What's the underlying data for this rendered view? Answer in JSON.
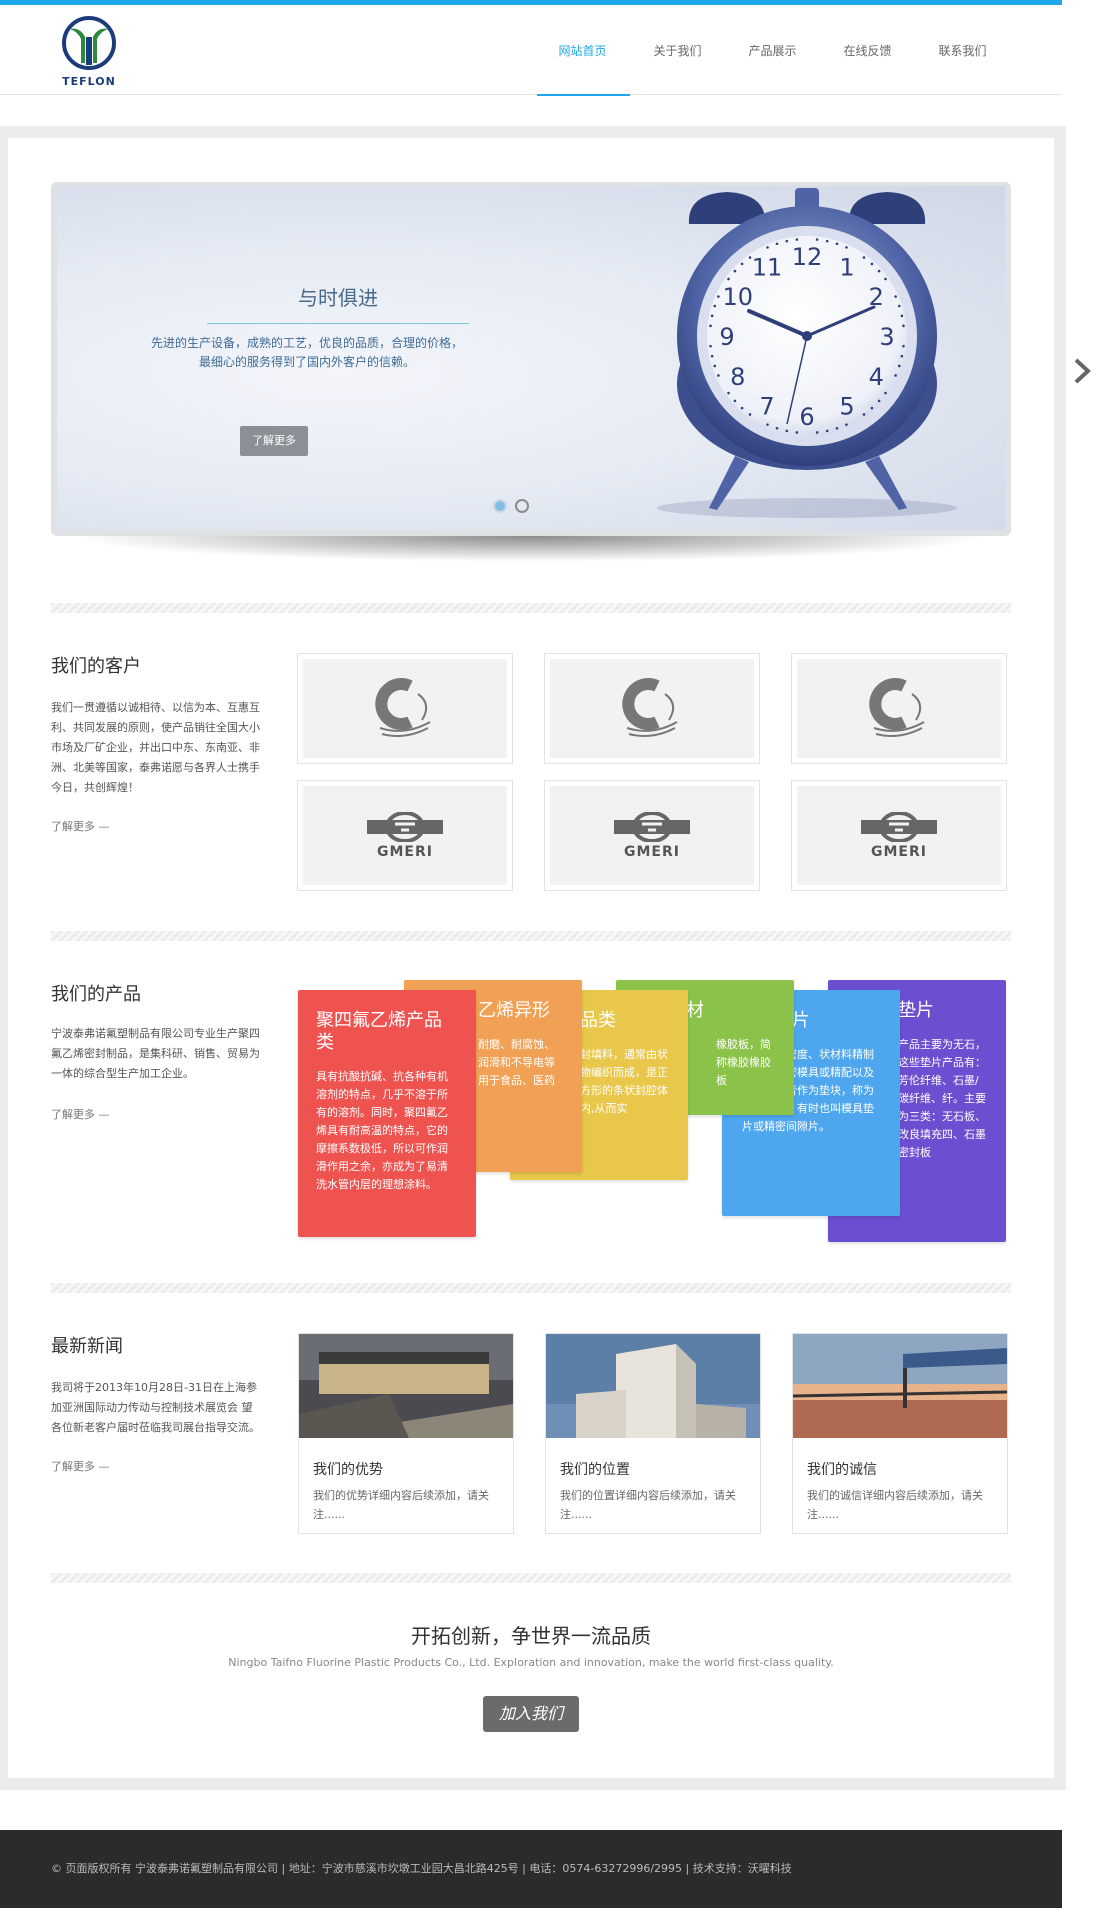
{
  "brand": {
    "logo_text": "TEFLON",
    "accent": "#1fa7e9"
  },
  "nav": {
    "items": [
      {
        "label": "网站首页",
        "active": true
      },
      {
        "label": "关于我们",
        "active": false
      },
      {
        "label": "产品展示",
        "active": false
      },
      {
        "label": "在线反馈",
        "active": false
      },
      {
        "label": "联系我们",
        "active": false
      }
    ]
  },
  "slider": {
    "title": "与时俱进",
    "text": "先进的生产设备，成熟的工艺，优良的品质，合理的价格，最细心的服务得到了国内外客户的信赖。",
    "button": "了解更多",
    "clock_numbers": [
      "12",
      "1",
      "2",
      "3",
      "4",
      "5",
      "6",
      "7",
      "8",
      "9",
      "10",
      "11"
    ]
  },
  "clients": {
    "title": "我们的客户",
    "text": "我们一贯遵循以诚相待、以信为本、互惠互利、共同发展的原则，使产品销往全国大小市场及厂矿企业，并出口中东、东南亚、非洲、北美等国家，泰弗诺愿与各界人士携手今日，共创辉煌！",
    "more": "了解更多 —",
    "logo_text": "GMERI"
  },
  "products": {
    "title": "我们的产品",
    "text": "宁波泰弗诺氟塑制品有限公司专业生产聚四氟乙烯密封制品，是集科研、销售、贸易为一体的综合型生产加工企业。",
    "more": "了解更多 —",
    "cards": [
      {
        "title": "聚四氟乙烯产品类",
        "text": "具有抗酸抗碱、抗各种有机溶剂的特点，几乎不溶于所有的溶剂。同时，聚四氟乙烯具有耐高温的特点，它的摩擦系数极低，所以可作润滑作用之余，亦成为了易清洗水管内层的理想涂料。",
        "color": "#ef5350"
      },
      {
        "title": "乙烯异形",
        "text": "耐磨、耐腐蚀、润滑和不导电等用于食品、医药",
        "color": "#f0a155"
      },
      {
        "title": "品类",
        "text": "封填料，通常由状物编织而成，是正方形的条状封腔体内,从而实",
        "color": "#e8c74a"
      },
      {
        "title": "材",
        "text": "橡胶板，简称橡胶橡胶板",
        "color": "#8bc34a"
      },
      {
        "title": "片",
        "text": "是由高精密度、状材料精制而件在精密模具或精配以及测量，或者作为垫块，称为精密垫片，有时也叫模具垫片或精密间隙片。",
        "color": "#4ea6ee"
      },
      {
        "title": "垫片",
        "text": "产品主要为无石，这些垫片产品有：芳伦纤维、石墨/碳纤维、纤。主要为三类：无石板、改良填充四、石墨密封板",
        "color": "#6c4fd1"
      }
    ]
  },
  "news": {
    "title": "最新新闻",
    "text": "我司将于2013年10月28日-31日在上海参加亚洲国际动力传动与控制技术展览会 望各位新老客户届时莅临我司展台指导交流。",
    "more": "了解更多 —",
    "items": [
      {
        "title": "我们的优势",
        "text": "我们的优势详细内容后续添加，请关注......"
      },
      {
        "title": "我们的位置",
        "text": "我们的位置详细内容后续添加，请关注......"
      },
      {
        "title": "我们的诚信",
        "text": "我们的诚信详细内容后续添加，请关注......"
      }
    ]
  },
  "cta": {
    "title": "开拓创新，争世界一流品质",
    "subtitle": "Ningbo Taifno Fluorine Plastic Products Co., Ltd. Exploration and innovation, make the world first-class quality.",
    "button": "加入我们"
  },
  "footer": {
    "text": "© 页面版权所有 宁波泰弗诺氟塑制品有限公司 | 地址：宁波市慈溪市坎墩工业园大昌北路425号 | 电话：0574-63272996/2995 | 技术支持：沃曜科技"
  }
}
